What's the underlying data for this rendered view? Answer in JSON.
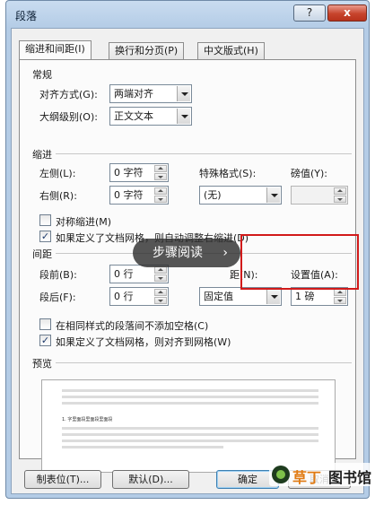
{
  "window": {
    "title": "段落",
    "help_glyph": "?",
    "close_glyph": "x"
  },
  "tabs": [
    {
      "label": "缩进和间距(I)",
      "active": true
    },
    {
      "label": "换行和分页(P)",
      "active": false
    },
    {
      "label": "中文版式(H)",
      "active": false
    }
  ],
  "general": {
    "heading": "常规",
    "alignment_label": "对齐方式(G):",
    "alignment_value": "两端对齐",
    "outline_label": "大纲级别(O):",
    "outline_value": "正文文本"
  },
  "indent": {
    "heading": "缩进",
    "left_label": "左侧(L):",
    "left_value": "0 字符",
    "right_label": "右侧(R):",
    "right_value": "0 字符",
    "special_label": "特殊格式(S):",
    "special_value": "(无)",
    "by_label": "磅值(Y):",
    "by_value": "",
    "mirror_label": "对称缩进(M)",
    "mirror_checked": false,
    "auto_right_label": "如果定义了文档网格，则自动调整右缩进(D)",
    "auto_right_checked": true
  },
  "spacing": {
    "heading": "间距",
    "before_label": "段前(B):",
    "before_value": "0 行",
    "after_label": "段后(F):",
    "after_value": "0 行",
    "line_label_fragment": "距(N):",
    "line_value": "固定值",
    "at_label": "设置值(A):",
    "at_value": "1 磅",
    "no_space_label": "在相同样式的段落间不添加空格(C)",
    "no_space_checked": false,
    "snap_grid_label": "如果定义了文档网格，则对齐到网格(W)",
    "snap_grid_checked": true
  },
  "preview": {
    "heading": "预览",
    "sample_text": "1. 字里面段里面段里面段"
  },
  "buttons": {
    "tabs_label": "制表位(T)...",
    "default_label": "默认(D)...",
    "ok_label": "确定",
    "cancel_label": "取消"
  },
  "overlay": {
    "label": "步骤阅读",
    "chevron": "›"
  },
  "watermark": {
    "text_a": "草丁",
    "text_b": "图书馆"
  },
  "colors": {
    "highlight_box": "#d11a1a",
    "titlebar": "#b4cce6",
    "close_button": "#c7442c"
  }
}
